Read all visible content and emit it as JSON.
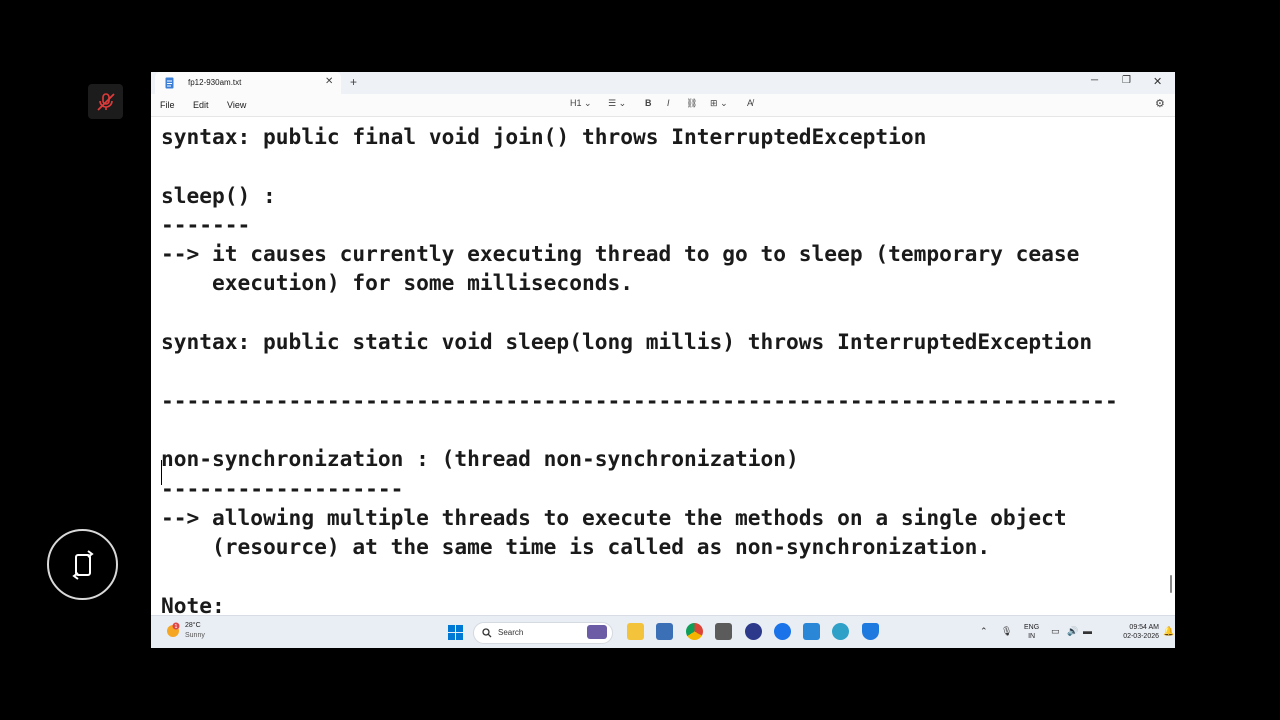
{
  "overlay": {
    "mic_icon": "mic-muted-icon",
    "screen_icon": "screen-rotate-icon"
  },
  "window": {
    "tab_title": "fp12-930am.txt",
    "menu": {
      "file": "File",
      "edit": "Edit",
      "view": "View"
    },
    "heading_dropdown": "H1",
    "bold": "B",
    "italic": "I"
  },
  "editor": {
    "lines": [
      "syntax: public final void join() throws InterruptedException",
      "",
      "sleep() :",
      "-------",
      "--> it causes currently executing thread to go to sleep (temporary cease",
      "    execution) for some milliseconds.",
      "",
      "syntax: public static void sleep(long millis) throws InterruptedException",
      "",
      "---------------------------------------------------------------------------",
      "",
      "non-synchronization : (thread non-synchronization)",
      "-------------------",
      "--> allowing multiple threads to execute the methods on a single object",
      "    (resource) at the same time is called as non-synchronization.",
      "",
      "Note:"
    ]
  },
  "taskbar": {
    "weather_temp": "28°C",
    "weather_condition": "Sunny",
    "weather_badge": "1",
    "search_placeholder": "Search",
    "lang_top": "ENG",
    "lang_bottom": "IN",
    "time": "09:54 AM",
    "date": "02-03-2026"
  },
  "colors": {
    "start_blue": "#0078d4",
    "text": "#1a1a1a",
    "taskbar_bg": "#e9edf4",
    "mic_muted_red": "#e03a3a"
  }
}
